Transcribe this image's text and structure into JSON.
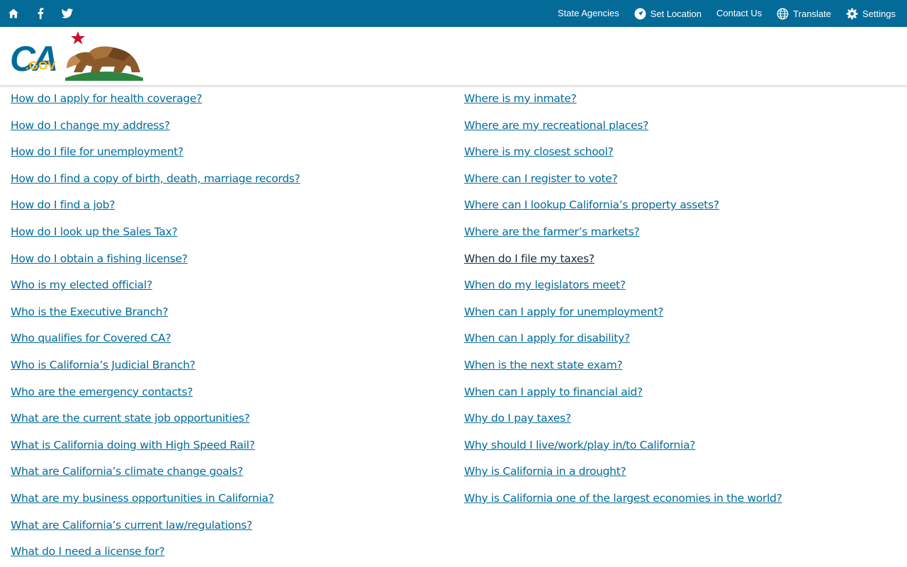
{
  "utility": {
    "left_icons": [
      "home-icon",
      "facebook-icon",
      "twitter-icon"
    ],
    "links": {
      "state_agencies": "State Agencies",
      "set_location": "Set Location",
      "contact_us": "Contact Us",
      "translate": "Translate",
      "settings": "Settings"
    }
  },
  "branding": {
    "logo_text": "CA.GOV"
  },
  "questions": {
    "left": [
      "How do I apply for health coverage?",
      "How do I change my address?",
      "How do I file for unemployment?",
      "How do I find a copy of birth, death, marriage records?",
      "How do I find a job?",
      "How do I look up the Sales Tax?",
      "How do I obtain a fishing license?",
      "Who is my elected official?",
      "Who is the Executive Branch?",
      "Who qualifies for Covered CA?",
      "Who is California’s Judicial Branch?",
      "Who are the emergency contacts?",
      "What are the current state job opportunities?",
      "What is California doing with High Speed Rail?",
      "What are California’s climate change goals?",
      "What are my business opportunities in California?",
      "What are California’s current law/regulations?",
      "What do I need a license for?"
    ],
    "right": [
      "Where is my inmate?",
      "Where are my recreational places?",
      "Where is my closest school?",
      "Where can I register to vote?",
      "Where can I lookup California’s property assets?",
      "Where are the farmer’s markets?",
      "When do I file my taxes?",
      "When do my legislators meet?",
      "When can I apply for unemployment?",
      "When can I apply for disability?",
      "When is the next state exam?",
      "When can I apply to financial aid?",
      "Why do I pay taxes?",
      "Why should I live/work/play in/to California?",
      "Why is California in a drought?",
      "Why is California one of the largest economies in the world?"
    ]
  },
  "colors": {
    "utility_bar": "#046b99",
    "link": "#046b99",
    "visited_link": "#1a2b3c"
  }
}
